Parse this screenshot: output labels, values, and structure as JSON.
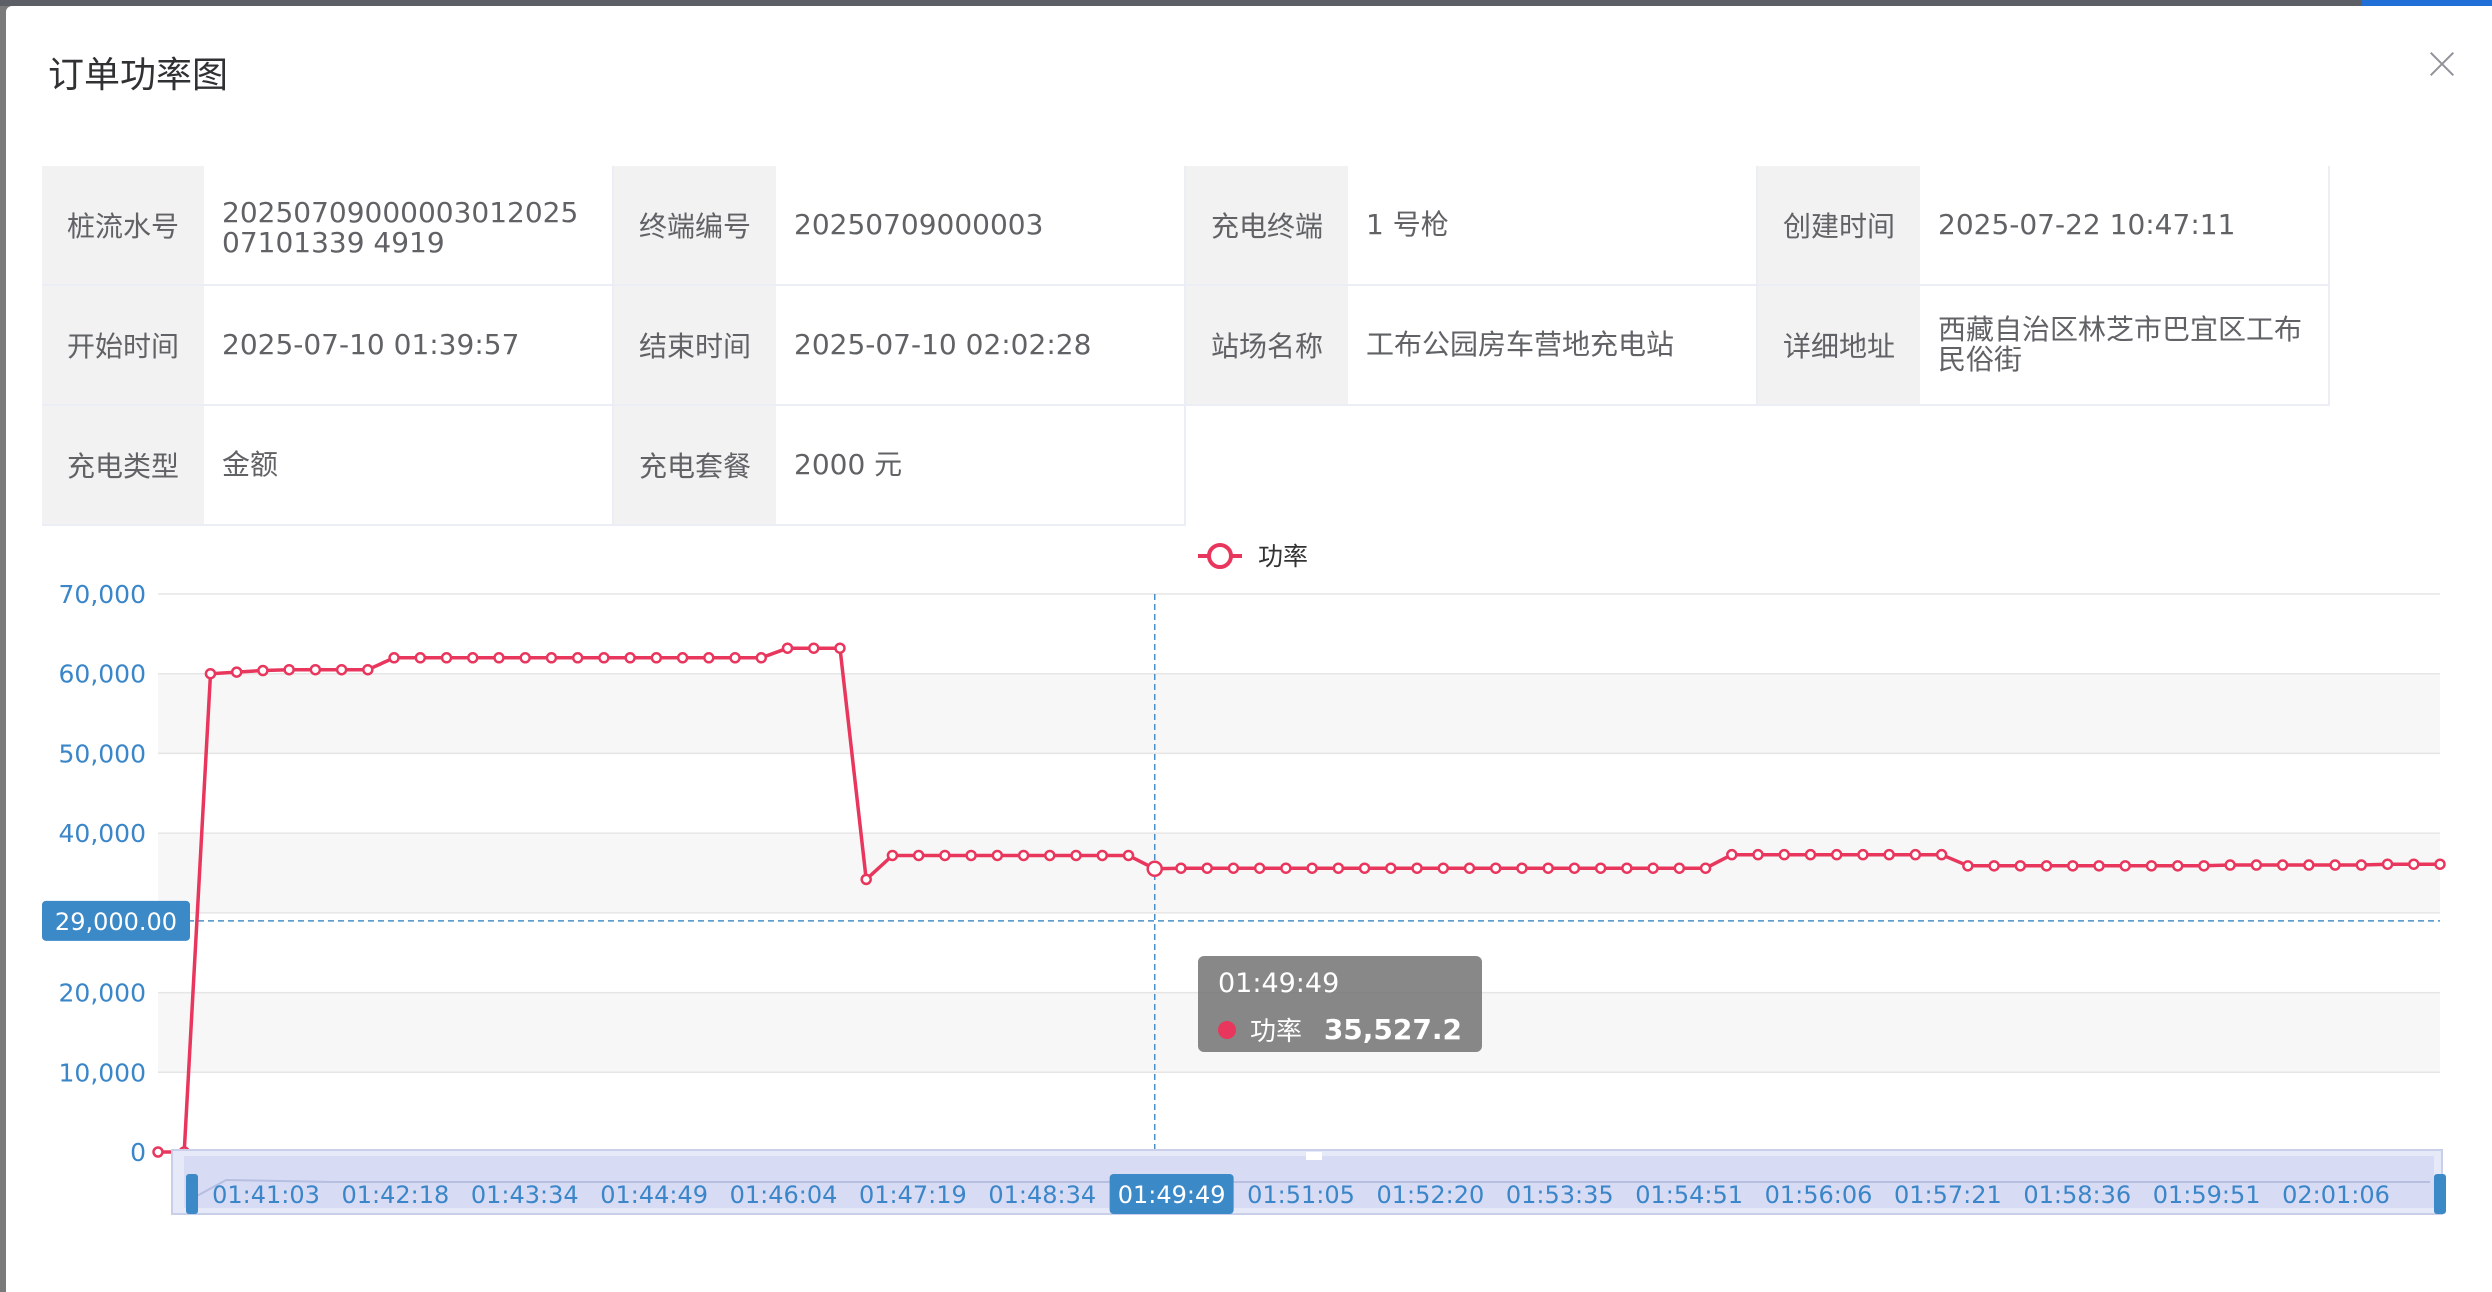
{
  "modal": {
    "title": "订单功率图"
  },
  "info": [
    {
      "label": "桩流水号",
      "value": "2025070900000301202507101339 4919"
    },
    {
      "label": "终端编号",
      "value": "20250709000003"
    },
    {
      "label": "充电终端",
      "value": "1 号枪"
    },
    {
      "label": "创建时间",
      "value": "2025-07-22 10:47:11"
    },
    {
      "label": "开始时间",
      "value": "2025-07-10 01:39:57"
    },
    {
      "label": "结束时间",
      "value": "2025-07-10 02:02:28"
    },
    {
      "label": "站场名称",
      "value": "工布公园房车营地充电站"
    },
    {
      "label": "详细地址",
      "value": "西藏自治区林芝市巴宜区工布民俗街"
    },
    {
      "label": "充电类型",
      "value": "金额"
    },
    {
      "label": "充电套餐",
      "value": "2000 元"
    }
  ],
  "chart_data": {
    "type": "line",
    "legend": [
      "功率"
    ],
    "series": [
      {
        "name": "功率",
        "color": "#e8365d",
        "values": [
          0,
          0,
          60000,
          60200,
          60400,
          60500,
          60500,
          60500,
          60500,
          62000,
          62000,
          62000,
          62000,
          62000,
          62000,
          62000,
          62000,
          62000,
          62000,
          62000,
          62000,
          62000,
          62000,
          62000,
          63200,
          63200,
          63200,
          34200,
          37200,
          37200,
          37200,
          37200,
          37200,
          37200,
          37200,
          37200,
          37200,
          37200,
          35527.2,
          35600,
          35600,
          35600,
          35600,
          35600,
          35600,
          35600,
          35600,
          35600,
          35600,
          35600,
          35600,
          35600,
          35600,
          35600,
          35600,
          35600,
          35600,
          35600,
          35600,
          35600,
          37300,
          37300,
          37300,
          37300,
          37300,
          37300,
          37300,
          37300,
          37300,
          35900,
          35900,
          35900,
          35900,
          35900,
          35900,
          35900,
          35900,
          35900,
          35900,
          36000,
          36000,
          36000,
          36000,
          36000,
          36000,
          36100,
          36100,
          36100
        ]
      }
    ],
    "x_tick_labels": [
      "01:41:03",
      "01:42:18",
      "01:43:34",
      "01:44:49",
      "01:46:04",
      "01:47:19",
      "01:48:34",
      "01:49:49",
      "01:51:05",
      "01:52:20",
      "01:53:35",
      "01:54:51",
      "01:56:06",
      "01:57:21",
      "01:58:36",
      "01:59:51",
      "02:01:06"
    ],
    "y_tick_labels": [
      "0",
      "10,000",
      "20,000",
      "30,000",
      "40,000",
      "50,000",
      "60,000",
      "70,000"
    ],
    "ylim": [
      0,
      70000
    ],
    "cursor_y_label": "29,000.00",
    "cursor_y_value": 29000,
    "cursor_x_label": "01:49:49",
    "cursor_x_index": 38,
    "grid": true
  },
  "tooltip": {
    "time": "01:49:49",
    "name": "功率",
    "value": "35,527.2"
  }
}
